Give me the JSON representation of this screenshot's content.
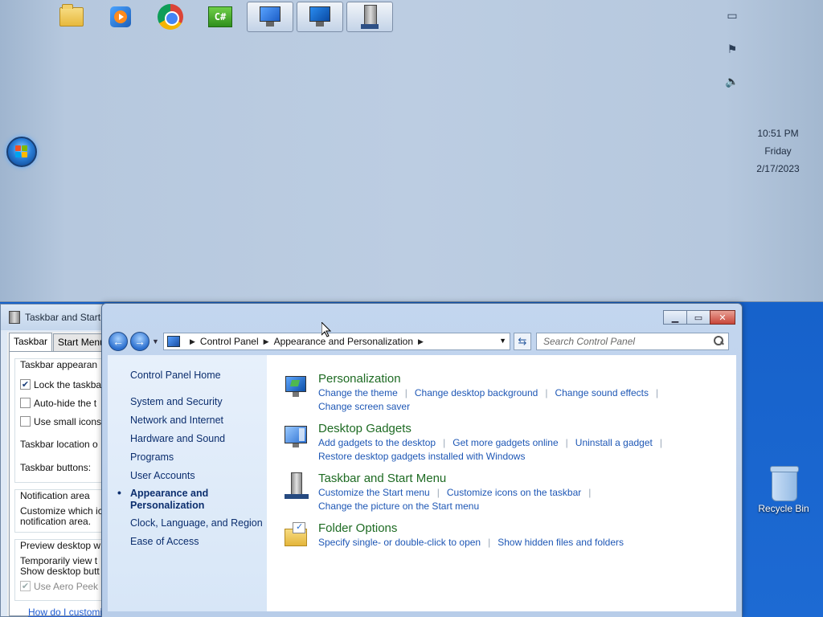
{
  "desktop": {
    "recycle_bin_label": "Recycle Bin"
  },
  "taskbar": {
    "pinned": [
      {
        "name": "Windows Explorer",
        "icon": "folder-icon"
      },
      {
        "name": "Windows Media Player",
        "icon": "media-player-icon"
      },
      {
        "name": "Google Chrome",
        "icon": "chrome-icon"
      },
      {
        "name": "C# project",
        "icon": "csharp-icon"
      },
      {
        "name": "Control Panel",
        "icon": "control-panel-icon",
        "active": true
      },
      {
        "name": "Display",
        "icon": "monitor-icon",
        "active": true
      },
      {
        "name": "Taskbar and Start Menu Properties",
        "icon": "tower-icon",
        "active": true
      }
    ],
    "clock": {
      "time": "10:51 PM",
      "day": "Friday",
      "date": "2/17/2023"
    }
  },
  "props_dialog": {
    "title": "Taskbar and Start",
    "tabs": [
      "Taskbar",
      "Start Menu"
    ],
    "group1_title": "Taskbar appearan",
    "opt_lock": "Lock the taskba",
    "opt_autohide": "Auto-hide the t",
    "opt_small": "Use small icons",
    "location_label": "Taskbar location o",
    "buttons_label": "Taskbar buttons:",
    "group2_title": "Notification area",
    "notif_line1": "Customize which ic",
    "notif_line2": "notification area.",
    "group3_title": "Preview desktop w",
    "preview_line1": "Temporarily view t",
    "preview_line2": "Show desktop butt",
    "opt_peek": "Use Aero Peek",
    "help_link": "How do I customize"
  },
  "control_panel": {
    "breadcrumb": [
      "Control Panel",
      "Appearance and Personalization"
    ],
    "search_placeholder": "Search Control Panel",
    "nav": {
      "home": "Control Panel Home",
      "items": [
        "System and Security",
        "Network and Internet",
        "Hardware and Sound",
        "Programs",
        "User Accounts"
      ],
      "active_line1": "Appearance and",
      "active_line2": "Personalization",
      "after": [
        "Clock, Language, and Region",
        "Ease of Access"
      ]
    },
    "tasks": [
      {
        "title": "Personalization",
        "icon": "personalization-icon",
        "links": [
          "Change the theme",
          "Change desktop background",
          "Change sound effects",
          "Change screen saver"
        ]
      },
      {
        "title": "Desktop Gadgets",
        "icon": "gadgets-icon",
        "links": [
          "Add gadgets to the desktop",
          "Get more gadgets online",
          "Uninstall a gadget",
          "Restore desktop gadgets installed with Windows"
        ]
      },
      {
        "title": "Taskbar and Start Menu",
        "icon": "taskbar-icon",
        "links": [
          "Customize the Start menu",
          "Customize icons on the taskbar",
          "Change the picture on the Start menu"
        ]
      },
      {
        "title": "Folder Options",
        "icon": "folder-options-icon",
        "links": [
          "Specify single- or double-click to open",
          "Show hidden files and folders"
        ]
      }
    ]
  }
}
